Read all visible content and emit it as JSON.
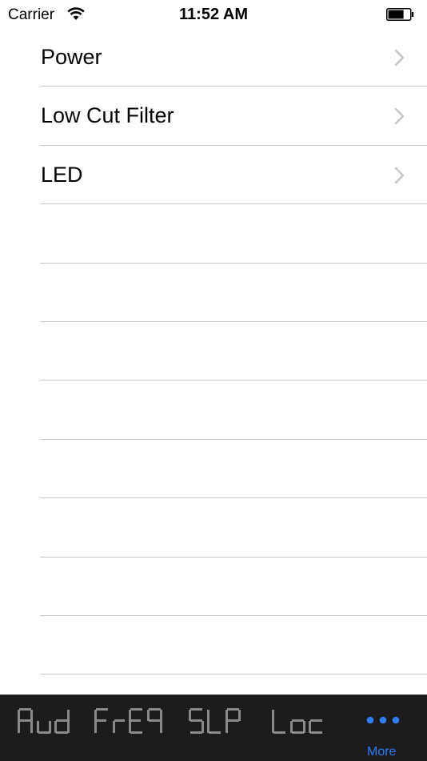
{
  "status_bar": {
    "carrier": "Carrier",
    "time": "11:52 AM"
  },
  "list": {
    "items": [
      {
        "label": "Power"
      },
      {
        "label": "Low Cut Filter"
      },
      {
        "label": "LED"
      }
    ],
    "empty_rows": 8
  },
  "tab_bar": {
    "tabs": [
      {
        "label": "Aud",
        "icon": "segment-display-aud-icon"
      },
      {
        "label": "FrEQ",
        "icon": "segment-display-freq-icon"
      },
      {
        "label": "SLP",
        "icon": "segment-display-slp-icon"
      },
      {
        "label": "Loc",
        "icon": "segment-display-loc-icon"
      }
    ],
    "more_label": "More"
  },
  "colors": {
    "tab_bar_bg": "#1c1c1e",
    "segment_color": "#8a8a8a",
    "accent": "#2f7cf6",
    "separator": "#c8c7cc",
    "chevron": "#c7c7cc"
  }
}
